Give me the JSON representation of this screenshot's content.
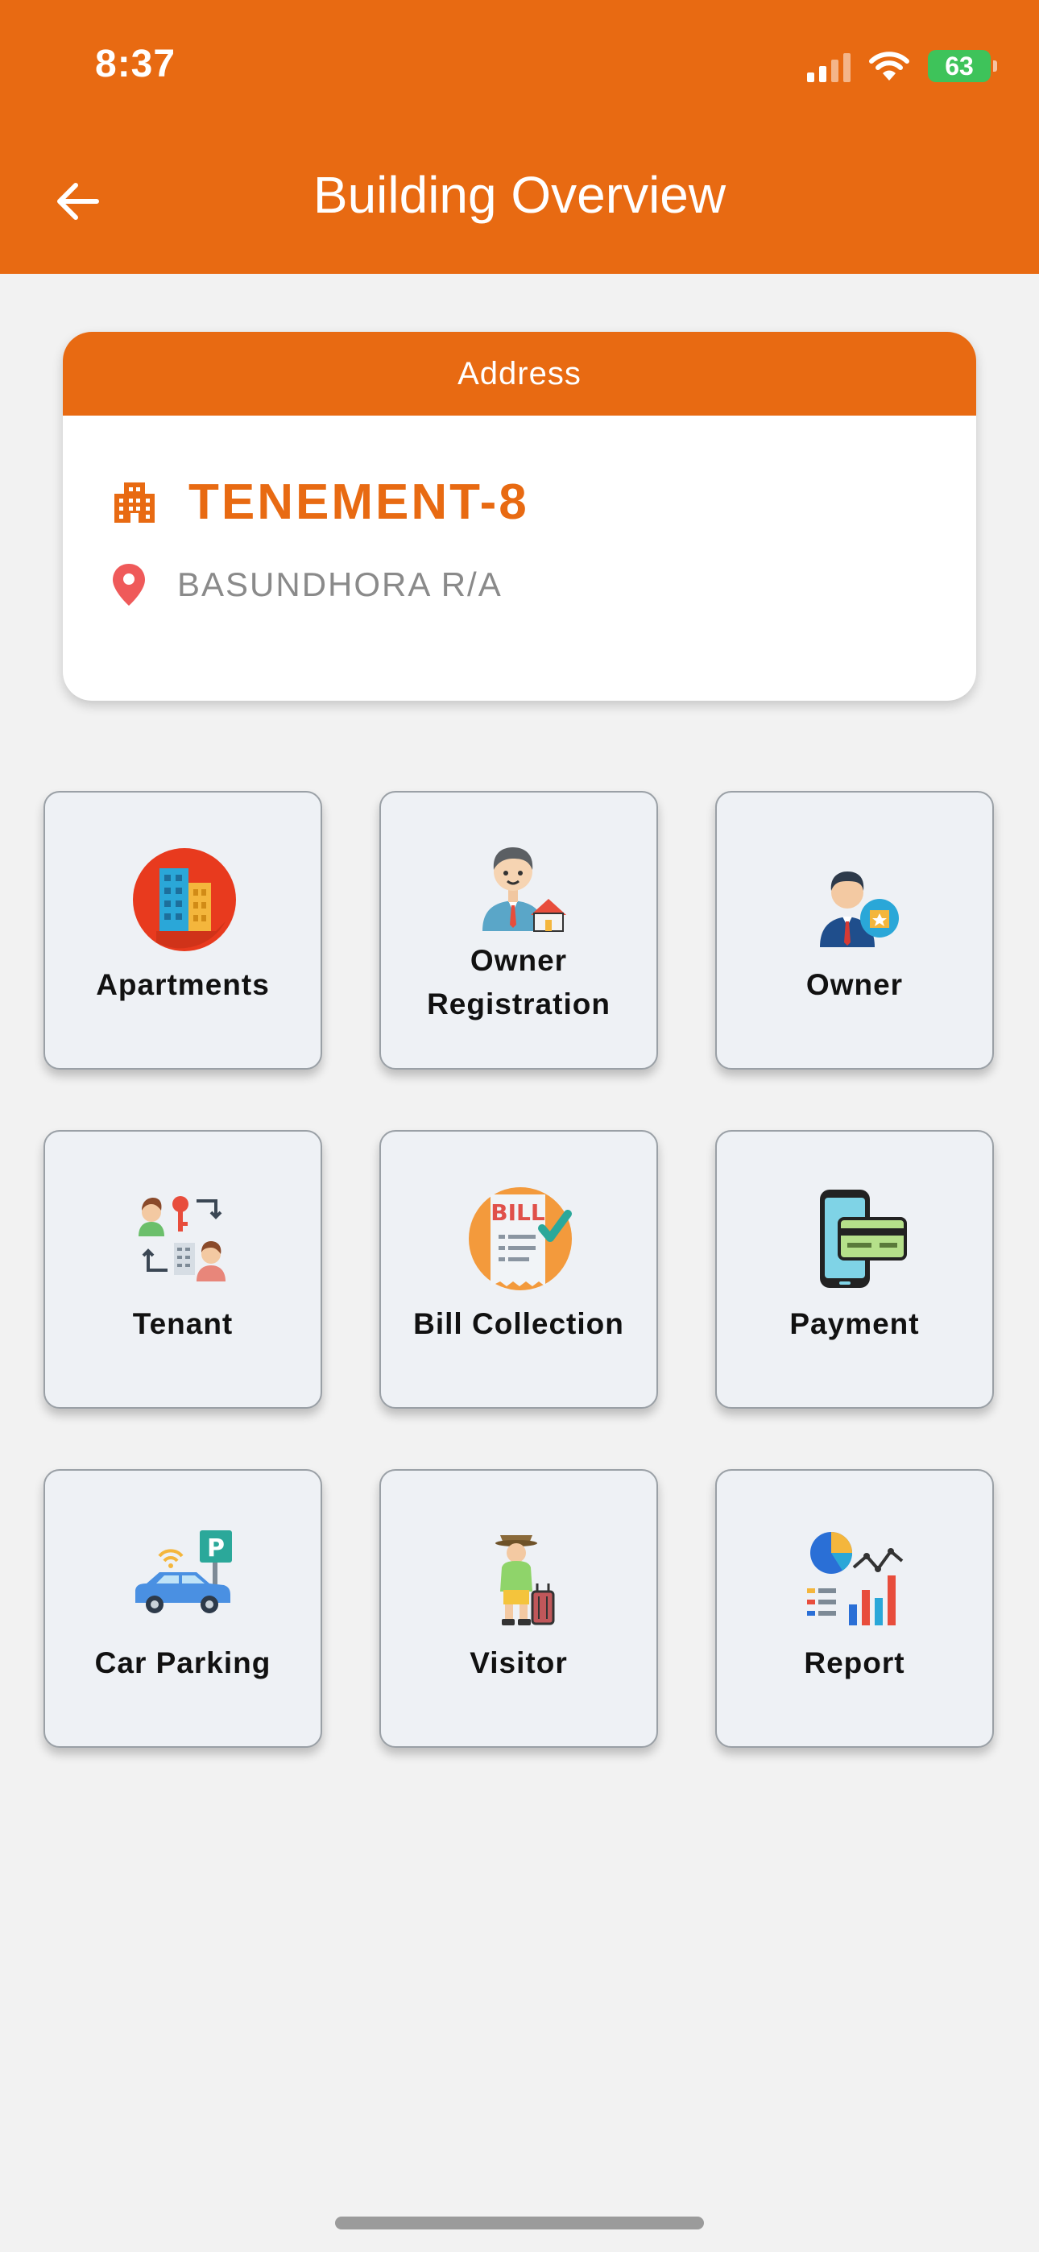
{
  "status_bar": {
    "time": "8:37",
    "battery": "63"
  },
  "header": {
    "title": "Building Overview",
    "back_icon": "arrow-left-icon"
  },
  "address_card": {
    "header": "Address",
    "building_name": "TENEMENT-8",
    "location": "BASUNDHORA R/A"
  },
  "menu": {
    "apartments": "Apartments",
    "owner_registration_line1": "Owner",
    "owner_registration_line2": "Registration",
    "owner": "Owner",
    "tenant": "Tenant",
    "bill_collection": "Bill Collection",
    "payment": "Payment",
    "car_parking": "Car Parking",
    "visitor": "Visitor",
    "report": "Report"
  },
  "bill_icon_text": "BILL",
  "parking_icon_text": "P",
  "colors": {
    "primary": "#e86a12",
    "tile_bg": "#eef1f5",
    "page_bg": "#f2f2f2"
  }
}
